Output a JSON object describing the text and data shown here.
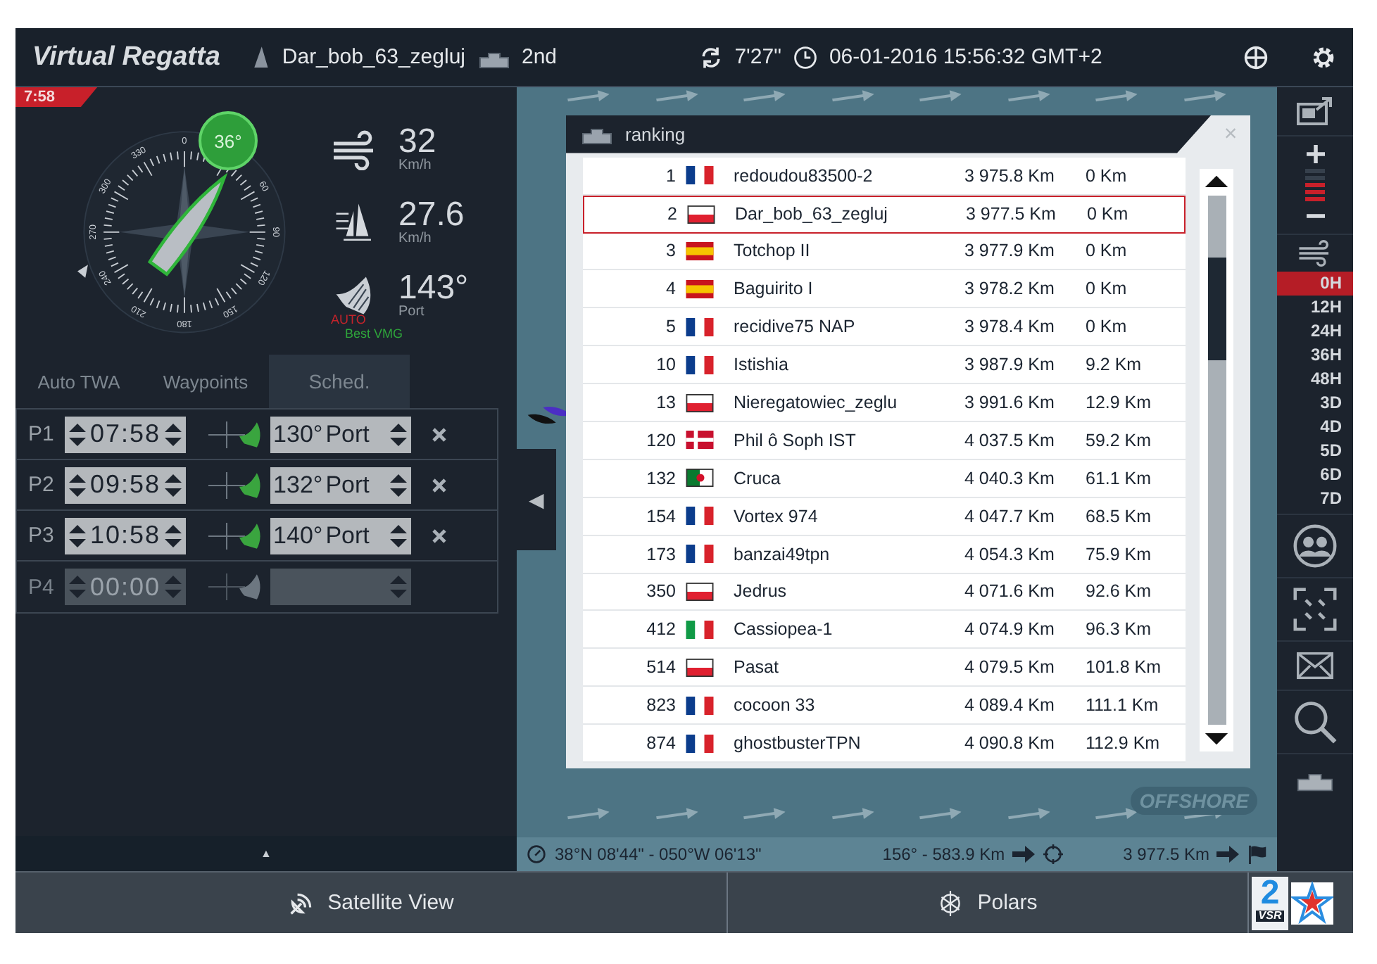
{
  "header": {
    "logo": "Virtual Regatta",
    "boat_name": "Dar_bob_63_zegluj",
    "rank": "2nd",
    "update_in": "7'27\"",
    "datetime": "06-01-2016 15:56:32 GMT+2"
  },
  "timer": "7:58",
  "compass": {
    "heading": "36°",
    "scale": [
      "0",
      "60",
      "90",
      "120",
      "150",
      "180",
      "210",
      "240",
      "270",
      "300",
      "330"
    ]
  },
  "instruments": [
    {
      "kind": "wind",
      "value": "32",
      "unit": "Km/h"
    },
    {
      "kind": "speed",
      "value": "27.6",
      "unit": "Km/h"
    },
    {
      "kind": "sail",
      "value": "143°",
      "unit": "Port",
      "mode": "AUTO",
      "hint": "Best VMG"
    }
  ],
  "tabs": [
    {
      "label": "Auto TWA",
      "selected": false
    },
    {
      "label": "Waypoints",
      "selected": false
    },
    {
      "label": "Sched.",
      "selected": true
    }
  ],
  "schedule": [
    {
      "label": "P1",
      "time": "07:58",
      "angle": "130°",
      "side": "Port",
      "disabled": false
    },
    {
      "label": "P2",
      "time": "09:58",
      "angle": "132°",
      "side": "Port",
      "disabled": false
    },
    {
      "label": "P3",
      "time": "10:58",
      "angle": "140°",
      "side": "Port",
      "disabled": false
    },
    {
      "label": "P4",
      "time": "00:00",
      "disabled": true
    }
  ],
  "panel_toggle": "▲",
  "map": {
    "side_toggle": "◀",
    "logo": "OFFSHORE"
  },
  "ranking": {
    "title": "ranking",
    "close": "×",
    "rows": [
      {
        "rank": "1",
        "kind": "fr",
        "name": "redoudou83500-2",
        "distance": "3 975.8 Km",
        "gap": "0 Km",
        "selected": false
      },
      {
        "rank": "2",
        "kind": "pl",
        "name": "Dar_bob_63_zegluj",
        "distance": "3 977.5 Km",
        "gap": "0 Km",
        "selected": true
      },
      {
        "rank": "3",
        "kind": "es",
        "name": "Totchop II",
        "distance": "3 977.9 Km",
        "gap": "0 Km",
        "selected": false
      },
      {
        "rank": "4",
        "kind": "es",
        "name": "Baguirito I",
        "distance": "3 978.2 Km",
        "gap": "0 Km",
        "selected": false
      },
      {
        "rank": "5",
        "kind": "fr",
        "name": "recidive75 NAP",
        "distance": "3 978.4 Km",
        "gap": "0 Km",
        "selected": false
      },
      {
        "rank": "10",
        "kind": "fr",
        "name": "Istishia",
        "distance": "3 987.9 Km",
        "gap": "9.2 Km",
        "selected": false
      },
      {
        "rank": "13",
        "kind": "pl",
        "name": "Nieregatowiec_zeglu",
        "distance": "3 991.6 Km",
        "gap": "12.9 Km",
        "selected": false
      },
      {
        "rank": "120",
        "kind": "dk",
        "name": "Phil ô Soph IST",
        "distance": "4 037.5 Km",
        "gap": "59.2 Km",
        "selected": false
      },
      {
        "rank": "132",
        "kind": "dz",
        "name": "Cruca",
        "distance": "4 040.3 Km",
        "gap": "61.1 Km",
        "selected": false
      },
      {
        "rank": "154",
        "kind": "fr",
        "name": "Vortex 974",
        "distance": "4 047.7 Km",
        "gap": "68.5 Km",
        "selected": false
      },
      {
        "rank": "173",
        "kind": "fr",
        "name": "banzai49tpn",
        "distance": "4 054.3 Km",
        "gap": "75.9 Km",
        "selected": false
      },
      {
        "rank": "350",
        "kind": "pl",
        "name": "Jedrus",
        "distance": "4 071.6 Km",
        "gap": "92.6 Km",
        "selected": false
      },
      {
        "rank": "412",
        "kind": "it",
        "name": "Cassiopea-1",
        "distance": "4 074.9 Km",
        "gap": "96.3 Km",
        "selected": false
      },
      {
        "rank": "514",
        "kind": "pl",
        "name": "Pasat",
        "distance": "4 079.5 Km",
        "gap": "101.8 Km",
        "selected": false
      },
      {
        "rank": "823",
        "kind": "fr",
        "name": "cocoon 33",
        "distance": "4 089.4 Km",
        "gap": "111.1 Km",
        "selected": false
      },
      {
        "rank": "874",
        "kind": "fr",
        "name": "ghostbusterTPN",
        "distance": "4 090.8 Km",
        "gap": "112.9 Km",
        "selected": false
      }
    ]
  },
  "zoom": {
    "level": 0.6
  },
  "forecast": [
    {
      "label": "0H",
      "selected": true
    },
    {
      "label": "12H",
      "selected": false
    },
    {
      "label": "24H",
      "selected": false
    },
    {
      "label": "36H",
      "selected": false
    },
    {
      "label": "48H",
      "selected": false
    },
    {
      "label": "3D",
      "selected": false
    },
    {
      "label": "4D",
      "selected": false
    },
    {
      "label": "5D",
      "selected": false
    },
    {
      "label": "6D",
      "selected": false
    },
    {
      "label": "7D",
      "selected": false
    }
  ],
  "status": {
    "position": "38°N 08'44\" - 050°W 06'13\"",
    "waypoint": "156° - 583.9 Km",
    "finish": "3 977.5 Km"
  },
  "bottom_buttons": [
    {
      "kind": "satellite",
      "label": "Satellite View"
    },
    {
      "kind": "polars",
      "label": "Polars"
    }
  ],
  "badge": {
    "number": "2",
    "label": "VSR"
  }
}
